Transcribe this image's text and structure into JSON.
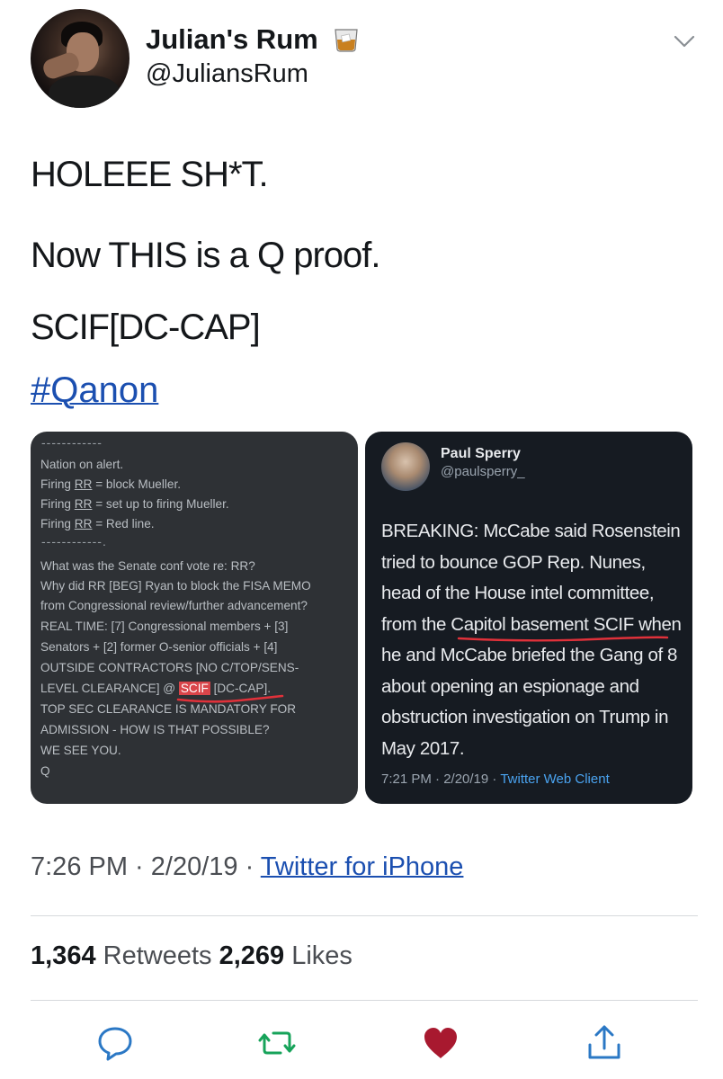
{
  "author": {
    "display_name": "Julian's Rum",
    "handle": "@JuliansRum",
    "emoji_icon": "whiskey-glass-icon"
  },
  "tweet": {
    "lines": [
      "HOLEEE SH*T.",
      "Now THIS is a Q proof.",
      "SCIF[DC-CAP]"
    ],
    "hashtag": "#Qanon"
  },
  "media_left": {
    "dash_top": "------------",
    "block1": [
      "Nation on alert.",
      "Firing RR = block Mueller.",
      "Firing RR = set up to firing Mueller.",
      "Firing RR = Red line."
    ],
    "dash_mid": "------------.",
    "block2": [
      "What was the Senate conf vote re: RR?",
      "Why did RR [BEG] Ryan to block the FISA MEMO",
      "from Congressional review/further advancement?",
      "REAL TIME: [7] Congressional members + [3]",
      "Senators + [2] former O-senior officials + [4]",
      "OUTSIDE CONTRACTORS [NO C/TOP/SENS-"
    ],
    "clearance_prefix": "LEVEL CLEARANCE] @ ",
    "scif": "SCIF",
    "dccap": "[DC-CAP]",
    "dccap_suffix": ".",
    "block3": [
      "TOP SEC CLEARANCE IS MANDATORY FOR",
      "ADMISSION - HOW IS THAT POSSIBLE?",
      "WE SEE YOU.",
      "Q"
    ]
  },
  "media_right": {
    "name": "Paul Sperry",
    "handle": "@paulsperry_",
    "text_lines": [
      "BREAKING: McCabe said Rosenstein",
      "tried to bounce GOP Rep. Nunes,",
      "head of the House intel committee,",
      "from the Capitol basement SCIF when",
      "he and McCabe briefed the Gang of 8",
      "about opening an espionage and",
      "obstruction investigation on Trump in",
      "May 2017."
    ],
    "meta_time": "7:21 PM · 2/20/19 · ",
    "meta_client": "Twitter Web Client"
  },
  "meta": {
    "time": "7:26 PM · 2/20/19 · ",
    "source": "Twitter for iPhone"
  },
  "stats": {
    "retweets_count": "1,364",
    "retweets_label": "Retweets",
    "likes_count": "2,269",
    "likes_label": "Likes"
  },
  "colors": {
    "link": "#1b4fb0",
    "like_heart": "#b3213a",
    "action_icon": "#1da1f2",
    "retweet_icon": "#17bf63"
  }
}
